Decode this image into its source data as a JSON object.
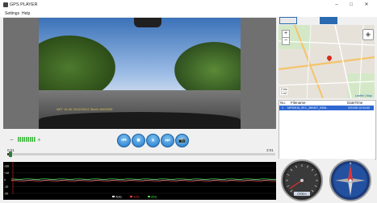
{
  "window": {
    "title": "GPS PLAYER",
    "minimize_glyph": "–",
    "maximize_glyph": "□",
    "close_glyph": "✕"
  },
  "menu": {
    "items": [
      "Settings",
      "Help"
    ]
  },
  "video": {
    "overlay_text": "NET 14.3K  2012/03/12  3km/h  8003030",
    "volume_minus": "−",
    "volume_plus": "+",
    "volume_level": 0.6
  },
  "playback": {
    "time_current": "0:01",
    "time_total": "3:01",
    "progress": 0.01,
    "buttons": [
      {
        "name": "previous-button",
        "icon": "previous-icon",
        "glyph": "⏮"
      },
      {
        "name": "stop-button",
        "icon": "stop-icon",
        "glyph": "■"
      },
      {
        "name": "pause-button",
        "icon": "pause-icon",
        "glyph": "⏸"
      },
      {
        "name": "next-button",
        "icon": "next-icon",
        "glyph": "⏭"
      },
      {
        "name": "snapshot-button",
        "icon": "camera-icon",
        "glyph": "📷"
      }
    ]
  },
  "graph": {
    "y_ticks": [
      "+20",
      "+10",
      "0",
      "-10",
      "-20"
    ],
    "legend": [
      {
        "label": "X(G)",
        "color": "#ffffff"
      },
      {
        "label": "Y(G)",
        "color": "#ff4040"
      },
      {
        "label": "Z(G)",
        "color": "#40ff40"
      }
    ]
  },
  "map": {
    "zoom_in": "+",
    "zoom_out": "−",
    "layers_glyph": "◈",
    "scale_1": "2 km",
    "scale_2": "1 mi",
    "attribution": "Leaflet | Map"
  },
  "file_table": {
    "columns": [
      "No.",
      "Filename",
      "DateTime"
    ],
    "rows": [
      {
        "no": "1",
        "filename": "MF00018_0KC_380407_0008...",
        "datetime": "2/21/06 12:04:50"
      }
    ]
  },
  "gauges": {
    "speed_unit": "km/h",
    "speed_readout": "0705 h",
    "compass_label": "N"
  },
  "colors": {
    "accent": "#1f77c9",
    "selection": "#2e67d0",
    "graph_bg": "#000000"
  }
}
